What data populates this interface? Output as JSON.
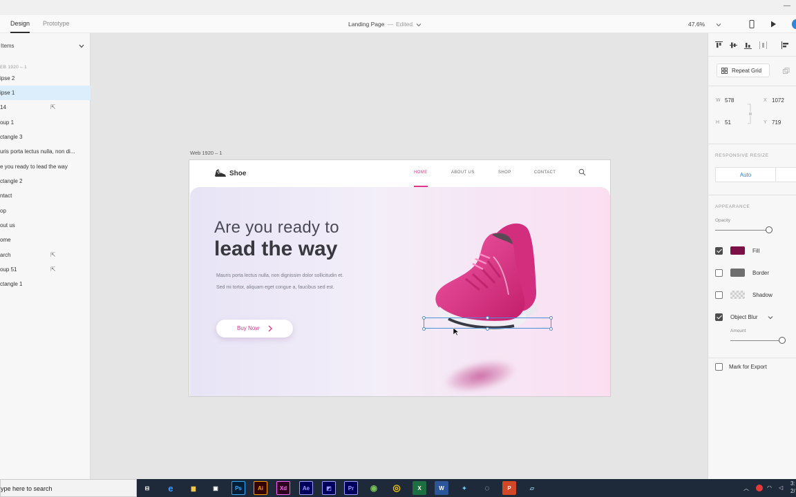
{
  "toolbar": {
    "tabs": [
      {
        "label": "Design"
      },
      {
        "label": "Prototype"
      }
    ],
    "doc_title": "Landing Page",
    "dash": "—",
    "doc_status": "Edited",
    "zoom": "47.6%"
  },
  "layers": {
    "header": "Items",
    "artboard_label": "EB 1920 – 1",
    "items": [
      {
        "label": "ipse 2"
      },
      {
        "label": "ipse 1"
      },
      {
        "label": "14"
      },
      {
        "label": "oup 1"
      },
      {
        "label": "ctangle 3"
      },
      {
        "label": "uris porta lectus nulla, non di..."
      },
      {
        "label": "e you ready to  lead the way"
      },
      {
        "label": "ctangle 2"
      },
      {
        "label": "ntact"
      },
      {
        "label": "op"
      },
      {
        "label": "out us"
      },
      {
        "label": "ome"
      },
      {
        "label": "arch"
      },
      {
        "label": "oup 51"
      },
      {
        "label": "ctangle 1"
      }
    ]
  },
  "artboard": {
    "label": "Web 1920 – 1",
    "logo": "Shoe",
    "nav": [
      {
        "label": "HOME"
      },
      {
        "label": "ABOUT US"
      },
      {
        "label": "SHOP"
      },
      {
        "label": "CONTACT"
      }
    ],
    "headline_light": "Are you ready to",
    "headline_bold": "lead the way",
    "paragraph": "Mauris porta lectus nulla, non dignissim dolor sollicitudin et. Sed mi tortor, aliquam eget congue a, faucibus sed est.",
    "cta": "Buy Now"
  },
  "inspector": {
    "repeat_grid": "Repeat Grid",
    "w_label": "W",
    "w": "578",
    "x_label": "X",
    "x": "1072",
    "h_label": "H",
    "h": "51",
    "y_label": "Y",
    "y": "719",
    "responsive_title": "RESPONSIVE RESIZE",
    "responsive_mode": "Auto",
    "appearance_title": "APPEARANCE",
    "opacity_label": "Opacity",
    "opacity_value": 1.0,
    "fill_label": "Fill",
    "fill_checked": true,
    "fill_color": "#7a1045",
    "border_label": "Border",
    "border_checked": false,
    "border_color": "#6e6e6e",
    "shadow_label": "Shadow",
    "shadow_checked": false,
    "blur_label": "Object Blur",
    "blur_checked": true,
    "amount_label": "Amount",
    "amount_value": 1.0,
    "export_label": "Mark for Export"
  },
  "taskbar": {
    "search_text": "ype here to search",
    "apps": [
      {
        "name": "task-view",
        "label": "⊟"
      },
      {
        "name": "edge",
        "label": "e"
      },
      {
        "name": "file-explorer",
        "label": "▆"
      },
      {
        "name": "store",
        "label": "▣"
      },
      {
        "name": "photoshop",
        "label": "Ps"
      },
      {
        "name": "illustrator",
        "label": "Ai"
      },
      {
        "name": "xd",
        "label": "Xd"
      },
      {
        "name": "after-effects",
        "label": "Ae"
      },
      {
        "name": "media-encoder",
        "label": "◩"
      },
      {
        "name": "premiere",
        "label": "Pr"
      },
      {
        "name": "android-studio",
        "label": "◉"
      },
      {
        "name": "chrome",
        "label": "◎"
      },
      {
        "name": "excel",
        "label": "X"
      },
      {
        "name": "word",
        "label": "W"
      },
      {
        "name": "app-pin",
        "label": "✦"
      },
      {
        "name": "obs",
        "label": "◌"
      },
      {
        "name": "powerpoint",
        "label": "P"
      },
      {
        "name": "notes",
        "label": "▱"
      }
    ],
    "clock_top": "3:",
    "clock_bottom": "2/"
  },
  "colors": {
    "accent_pink": "#e0338a",
    "selection_blue": "#4a90d9",
    "layer_selected": "#dceefb"
  }
}
